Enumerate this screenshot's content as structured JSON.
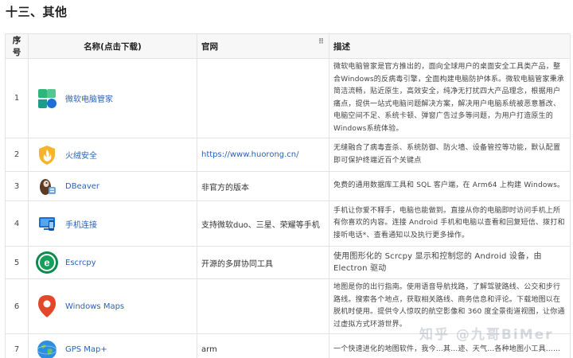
{
  "section": {
    "title": "十三、其他"
  },
  "table": {
    "headers": {
      "no": "序号",
      "name": "名称(点击下载)",
      "site": "官网",
      "desc": "描述",
      "drag_glyph": "⠿"
    },
    "rows": [
      {
        "no": "1",
        "name": "微软电脑管家",
        "site": "",
        "icon": "microsoft-pc-manager-icon",
        "desc": "微软电脑管家是官方推出的，面向全球用户的桌面安全工具类产品，整合Windows的反病毒引擎，全面构建电脑防护体系。微软电脑管家秉承简洁流畅，贴近原生，高效安全，纯净无打扰四大产品理念，根据用户痛点，提供一站式电脑问题解决方案，解决用户电脑系统被恶意篡改、电脑空间不足、系统卡顿、弹窗广告过多等问题，为用户打造原生的Windows系统体验。"
      },
      {
        "no": "2",
        "name": "火绒安全",
        "site": "https://www.huorong.cn/",
        "icon": "huorong-shield-icon",
        "desc": "无缝融合了病毒查杀、系统防御、防火墙、设备管控等功能，默认配置即可保护终端近百个关键点"
      },
      {
        "no": "3",
        "name": "DBeaver",
        "site": "非官方的版本",
        "icon": "dbeaver-beaver-icon",
        "desc": "免费的通用数据库工具和 SQL 客户端，在 Arm64 上构建 Windows。"
      },
      {
        "no": "4",
        "name": "手机连接",
        "site": "支持微软duo、三星、荣耀等手机",
        "icon": "phone-link-icon",
        "desc": "手机让你爱不释手，电脑也能做到。直接从你的电脑即时访问手机上所有你喜欢的内容。连接 Android 手机和电脑以查看和回复短信、拨打和接听电话*、查看通知以及执行更多操作。"
      },
      {
        "no": "5",
        "name": "Escrcpy",
        "site": "开源的多屏协同工具",
        "icon": "escrcpy-icon",
        "desc": "使用图形化的 Scrcpy 显示和控制您的 Android 设备，由 Electron 驱动"
      },
      {
        "no": "6",
        "name": "Windows Maps",
        "site": "",
        "icon": "map-pin-icon",
        "desc": "地图是你的出行指南。使用语音导航找路，了解驾驶路线、公交和步行路线。搜索各个地点，获取相关路线、商务信息和评论。下载地图以在脱机时使用。提供令人惊叹的航空影像和 360 度全景街道视图，让你通过虚拟方式环游世界。"
      },
      {
        "no": "7",
        "name": "GPS Map+",
        "site": "arm",
        "icon": "globe-icon",
        "desc": "一个快速进化的地图软件，我今…其…迹、天气…各种地图小工具……"
      }
    ]
  },
  "watermark": {
    "text": "知乎 @九哥BiMer"
  }
}
